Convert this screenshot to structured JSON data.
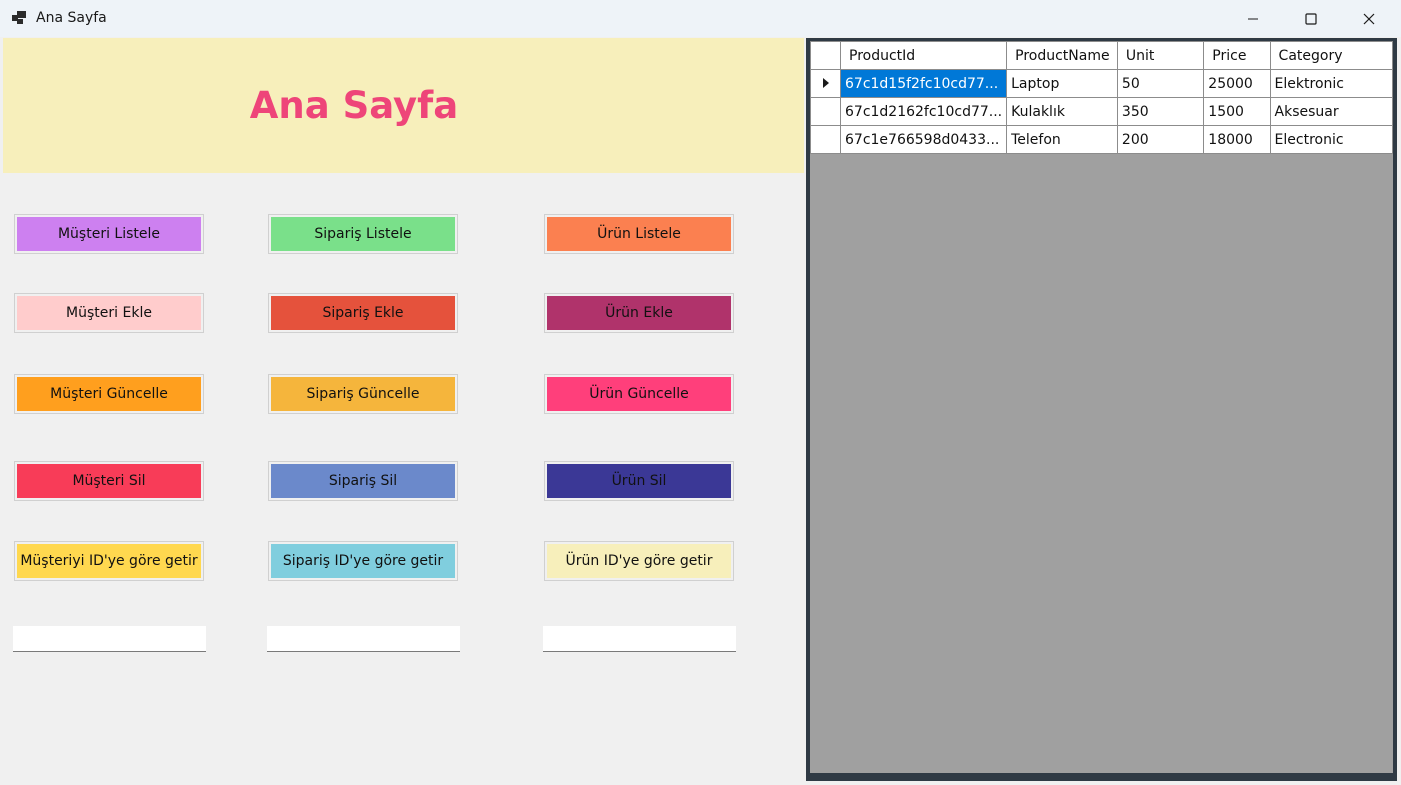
{
  "window": {
    "title": "Ana Sayfa",
    "icon": "app-window-icon"
  },
  "header": {
    "title": "Ana Sayfa",
    "background": "#f7efbb",
    "title_color": "#ee4579"
  },
  "buttons": {
    "musteri_listele": "Müşteri Listele",
    "siparis_listele": "Sipariş Listele",
    "urun_listele": "Ürün Listele",
    "musteri_ekle": "Müşteri Ekle",
    "siparis_ekle": "Sipariş Ekle",
    "urun_ekle": "Ürün Ekle",
    "musteri_guncelle": "Müşteri Güncelle",
    "siparis_guncelle": "Sipariş Güncelle",
    "urun_guncelle": "Ürün Güncelle",
    "musteri_sil": "Müşteri Sil",
    "siparis_sil": "Sipariş Sil",
    "urun_sil": "Ürün Sil",
    "musteri_getir": "Müşteriyi ID'ye göre getir",
    "siparis_getir": "Sipariş ID'ye göre getir",
    "urun_getir": "Ürün ID'ye göre getir"
  },
  "button_colors": {
    "musteri_listele": "#cd80f0",
    "siparis_listele": "#7ae08a",
    "urun_listele": "#fb8050",
    "musteri_ekle": "#ffcccc",
    "siparis_ekle": "#e5523c",
    "urun_ekle": "#b0336b",
    "musteri_guncelle": "#ff9f1e",
    "siparis_guncelle": "#f5b53c",
    "urun_guncelle": "#ff3f7b",
    "musteri_sil": "#f83c58",
    "siparis_sil": "#6b89cb",
    "urun_sil": "#3b3896",
    "musteri_getir": "#ffd84f",
    "siparis_getir": "#80cede",
    "urun_getir": "#f7efbb"
  },
  "inputs": {
    "musteri_id": {
      "value": "",
      "placeholder": ""
    },
    "siparis_id": {
      "value": "",
      "placeholder": ""
    },
    "urun_id": {
      "value": "",
      "placeholder": ""
    }
  },
  "grid": {
    "columns": [
      "ProductId",
      "ProductName",
      "Unit",
      "Price",
      "Category"
    ],
    "rows": [
      [
        "67c1d15f2fc10cd77...",
        "Laptop",
        "50",
        "25000",
        "Elektronic"
      ],
      [
        "67c1d2162fc10cd77...",
        "Kulaklık",
        "350",
        "1500",
        "Aksesuar"
      ],
      [
        "67c1e766598d0433...",
        "Telefon",
        "200",
        "18000",
        "Electronic"
      ]
    ],
    "selected_row": 0,
    "current_row_indicator": "row-pointer-icon"
  }
}
